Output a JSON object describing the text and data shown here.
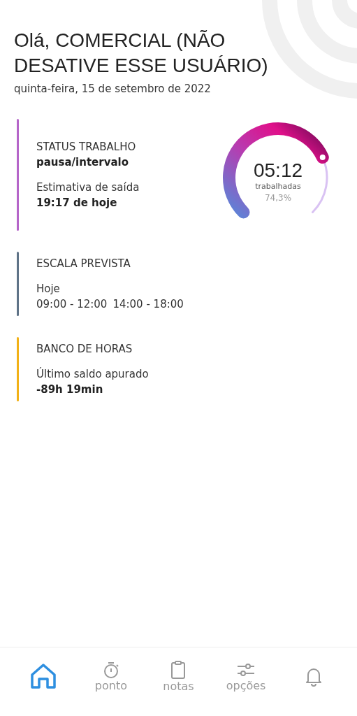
{
  "greeting": "Olá, COMERCIAL (NÃO DESATIVE ESSE USUÁRIO)",
  "date": "quinta-feira, 15 de setembro de 2022",
  "cards": [
    {
      "kind": "status",
      "color": "#b565c9",
      "title": "STATUS TRABALHO",
      "value": "pausa/intervalo",
      "label": "Estimativa de saída",
      "value2": "19:17 de hoje",
      "gauge": {
        "time": "05:12",
        "caption": "trabalhadas",
        "percent": "74,3%"
      }
    },
    {
      "kind": "schedule",
      "color": "#5f7387",
      "title": "ESCALA PREVISTA",
      "label": "Hoje",
      "periods": [
        "09:00 - 12:00",
        "14:00 - 18:00"
      ]
    },
    {
      "kind": "bank",
      "color": "#f2b117",
      "title": "BANCO DE HORAS",
      "label": "Último saldo apurado",
      "value": "-89h 19min"
    }
  ],
  "nav": [
    {
      "kind": "home",
      "selected": true
    },
    {
      "kind": "clock",
      "label": "ponto",
      "selected": false
    },
    {
      "kind": "notes",
      "label": "notas",
      "selected": false
    },
    {
      "kind": "options",
      "label": "opções",
      "selected": false
    },
    {
      "kind": "bell",
      "selected": false
    }
  ]
}
